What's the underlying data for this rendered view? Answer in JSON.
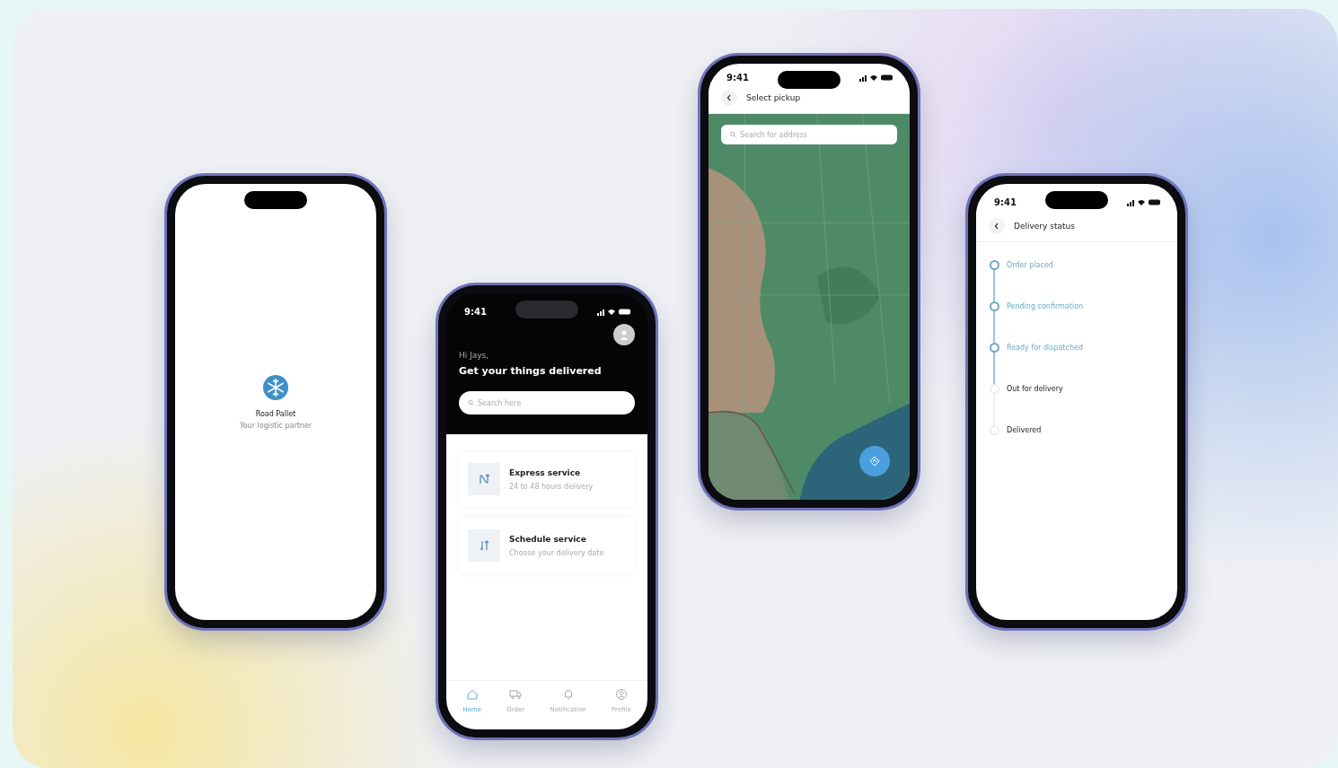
{
  "phones": [
    {
      "kind": "splash",
      "brand": "Road Pallet",
      "tagline": "Your logistic partner"
    },
    {
      "kind": "home",
      "time": "9:41",
      "greeting": "Hi Jays,",
      "headline": "Get your things delivered",
      "search": {
        "placeholder": "Search here"
      },
      "services": [
        {
          "title": "Express service",
          "subtitle": "24 to 48 hours delivery",
          "kind": "express"
        },
        {
          "title": "Schedule service",
          "subtitle": "Choose your delivery date",
          "kind": "schedule"
        }
      ],
      "nav": [
        {
          "label": "Home",
          "kind": "home",
          "selected": true
        },
        {
          "label": "Order",
          "kind": "order",
          "selected": false
        },
        {
          "label": "Notification",
          "kind": "bell",
          "selected": false
        },
        {
          "label": "Profile",
          "kind": "profile",
          "selected": false
        }
      ]
    },
    {
      "kind": "map",
      "time": "9:41",
      "title": "Select pickup",
      "search": {
        "placeholder": "Search for address"
      }
    },
    {
      "kind": "status",
      "time": "9:41",
      "title": "Delivery status",
      "steps": [
        {
          "label": "Order placed",
          "done": true
        },
        {
          "label": "Pending confirmation",
          "done": true
        },
        {
          "label": "Ready for dispatched",
          "done": true
        },
        {
          "label": "Out for delivery",
          "done": false
        },
        {
          "label": "Delivered",
          "done": false
        }
      ]
    }
  ]
}
